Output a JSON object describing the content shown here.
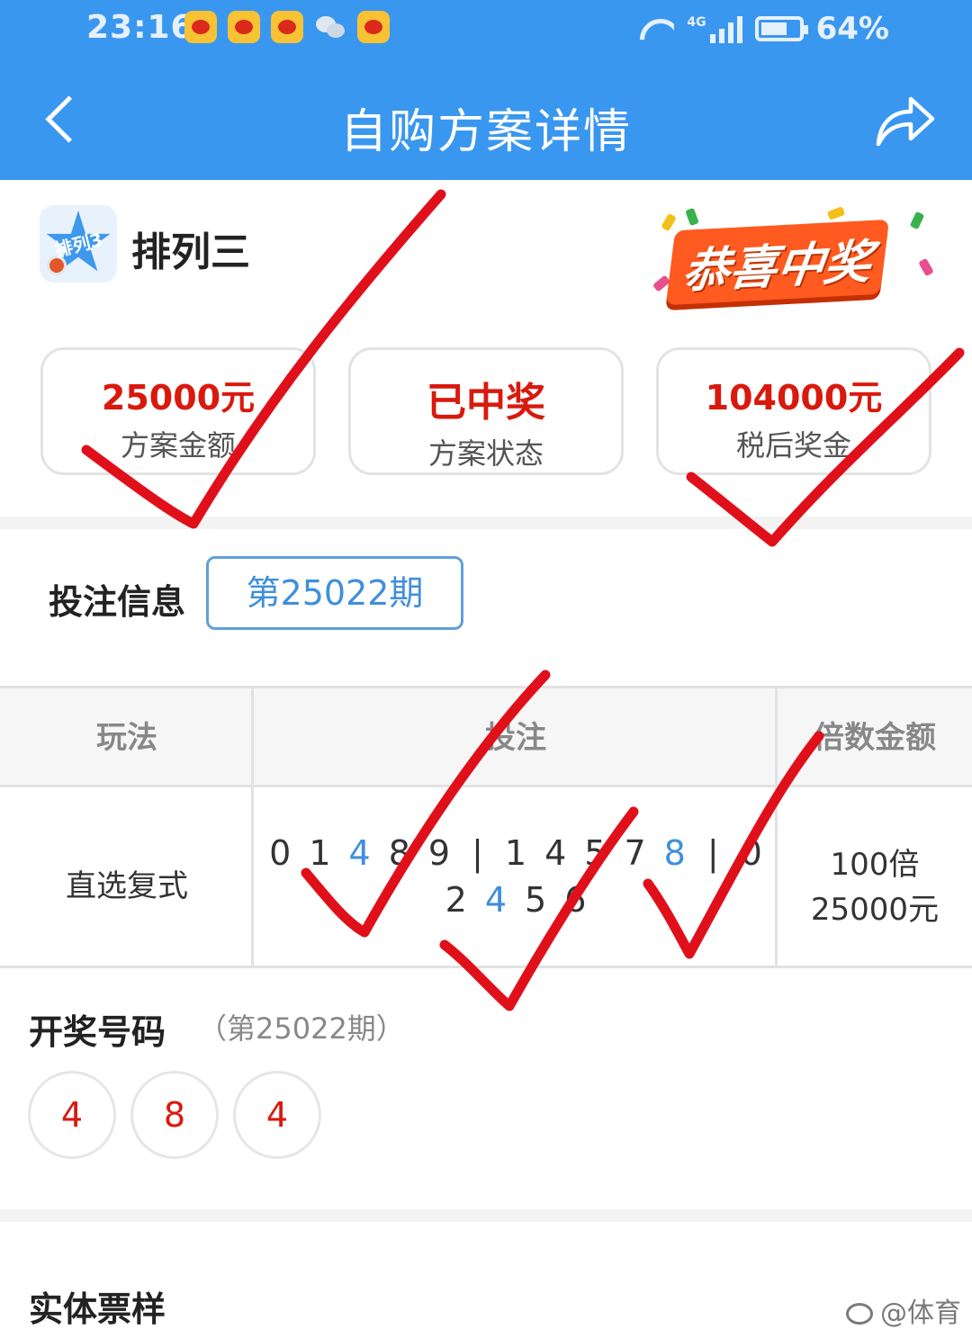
{
  "status_bar": {
    "time": "23:16",
    "network": "4G",
    "battery": "64%",
    "notification_icons": [
      "weibo-icon",
      "weibo-icon",
      "weibo-icon",
      "wechat-icon",
      "weibo-icon"
    ]
  },
  "app_bar": {
    "title": "自购方案详情"
  },
  "lottery": {
    "name": "排列三",
    "logo_text": "排列3",
    "badge": "恭喜中奖"
  },
  "summary": [
    {
      "value": "25000元",
      "label": "方案金额"
    },
    {
      "value": "已中奖",
      "label": "方案状态"
    },
    {
      "value": "104000元",
      "label": "税后奖金"
    }
  ],
  "bet_info": {
    "title": "投注信息",
    "issue_button": "第25022期",
    "table": {
      "headers": [
        "玩法",
        "投注",
        "倍数金额"
      ],
      "play_type": "直选复式",
      "numbers_line1": [
        {
          "text": "0",
          "hit": false
        },
        {
          "text": "1",
          "hit": false
        },
        {
          "text": "4",
          "hit": true
        },
        {
          "text": "8",
          "hit": false
        },
        {
          "text": "9",
          "hit": false
        },
        {
          "text": "|",
          "sep": true
        },
        {
          "text": "1",
          "hit": false
        },
        {
          "text": "4",
          "hit": false
        },
        {
          "text": "5",
          "hit": false
        },
        {
          "text": "7",
          "hit": false
        },
        {
          "text": "8",
          "hit": true
        },
        {
          "text": "|",
          "sep": true
        },
        {
          "text": "0",
          "hit": false
        }
      ],
      "numbers_line2": [
        {
          "text": "2",
          "hit": false
        },
        {
          "text": "4",
          "hit": true
        },
        {
          "text": "5",
          "hit": false
        },
        {
          "text": "6",
          "hit": false
        }
      ],
      "multiple": "100倍",
      "amount": "25000元"
    }
  },
  "draw": {
    "title": "开奖号码",
    "issue": "（第25022期）",
    "numbers": [
      "4",
      "8",
      "4"
    ]
  },
  "ticket": {
    "title": "实体票样"
  },
  "watermark": "@体育",
  "colors": {
    "primary": "#3a97f0",
    "prize_red": "#d9190d",
    "hit_blue": "#3f8fdc",
    "checkmark": "#e0101a"
  }
}
